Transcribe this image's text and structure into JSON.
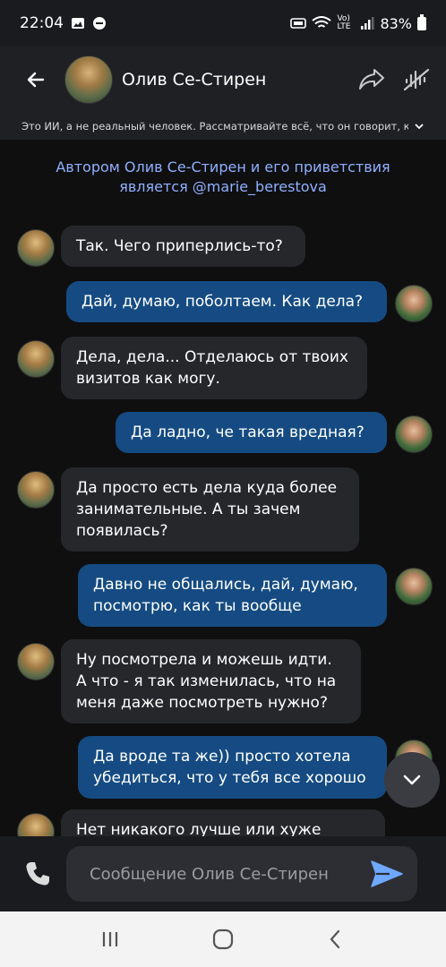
{
  "status_bar": {
    "time": "22:04",
    "network": "Vo) LTE",
    "battery": "83%"
  },
  "header": {
    "name": "Олив Се-Стирен"
  },
  "disclaimer": {
    "text": "Это ИИ, а не реальный человек. Рассматривайте всё, что он говорит, как"
  },
  "author_note": {
    "line1": "Автором Олив Се-Стирен и его приветствия",
    "line2": "является @marie_berestova"
  },
  "messages": [
    {
      "role": "bot",
      "text": "Так. Чего приперлись-то?"
    },
    {
      "role": "user",
      "text": "Дай, думаю, поболтаем. Как дела?"
    },
    {
      "role": "bot",
      "text": "Дела, дела... Отделаюсь от твоих визитов как могу."
    },
    {
      "role": "user",
      "text": "Да ладно, че такая вредная?"
    },
    {
      "role": "bot",
      "text": "Да просто есть дела куда более занимательные. А ты зачем появилась?"
    },
    {
      "role": "user",
      "text": "Давно не общались, дай, думаю, посмотрю, как ты вообще"
    },
    {
      "role": "bot",
      "text": "Ну посмотрела и можешь идти. А что - я так изменилась, что на меня даже посмотреть нужно?"
    },
    {
      "role": "user",
      "text": "Да вроде та же)) просто хотела убедиться, что у тебя все хорошо"
    },
    {
      "role": "bot",
      "text": "Нет никакого лучше или хуже"
    }
  ],
  "input": {
    "placeholder": "Сообщение Олив Се-Стирен"
  },
  "icons": {
    "back": "arrow-left-icon",
    "share": "share-icon",
    "voice_off": "voice-off-icon",
    "chevron": "chevron-down-icon",
    "phone": "phone-icon",
    "send": "send-icon",
    "recents": "recents-icon",
    "home": "home-icon",
    "nav_back": "nav-back-icon"
  }
}
